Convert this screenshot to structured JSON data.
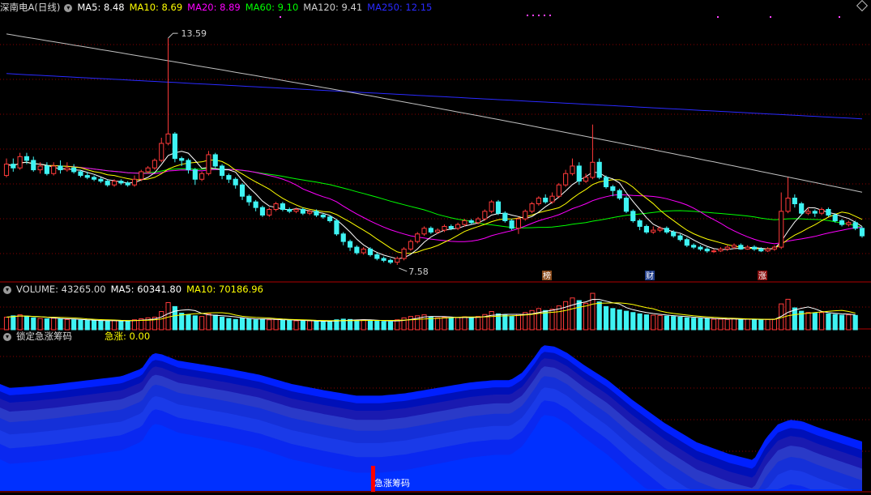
{
  "main_header": {
    "stock": "深南电A(日线)",
    "ma5": "MA5: 8.48",
    "ma10": "MA10: 8.69",
    "ma20": "MA20: 8.89",
    "ma60": "MA60: 9.10",
    "ma120": "MA120: 9.41",
    "ma250": "MA250: 12.15"
  },
  "volume_header": {
    "volume": "VOLUME: 43265.00",
    "ma5": "MA5: 60341.80",
    "ma10": "MA10: 70186.96"
  },
  "indicator_header": {
    "name": "锁定急涨筹码",
    "value": "急涨: 0.00"
  },
  "annotations": {
    "high": "13.59",
    "low": "7.58",
    "tag_bang": "榜",
    "tag_cai": "财",
    "tag_zhang": "涨",
    "signal": "急涨筹码"
  },
  "colors": {
    "up": "#ff3a3a",
    "down": "#3ff3f3",
    "ma5": "#ffffff",
    "ma10": "#ffff00",
    "ma20": "#ff00ff",
    "ma60": "#00ff00",
    "ma120": "#c0c0c0",
    "ma250": "#2a2aff",
    "grid": "#8b0000",
    "fill": "#0000ff"
  },
  "chart_data": {
    "type": "candlestick",
    "ylim": [
      7.3,
      14.3
    ],
    "ylim_volume": [
      0,
      115000
    ],
    "high_marker": 13.59,
    "low_marker": 7.58,
    "candles": [
      [
        9.95,
        10.25,
        10.4,
        9.9
      ],
      [
        10.25,
        10.15,
        10.4,
        10.05
      ],
      [
        10.15,
        10.45,
        10.55,
        10.1
      ],
      [
        10.45,
        10.35,
        10.55,
        10.25
      ],
      [
        10.35,
        10.1,
        10.45,
        10.05
      ],
      [
        10.1,
        10.2,
        10.3,
        10.0
      ],
      [
        10.2,
        10.0,
        10.3,
        9.95
      ],
      [
        10.0,
        10.2,
        10.3,
        9.95
      ],
      [
        10.2,
        10.1,
        10.35,
        10.0
      ],
      [
        10.1,
        10.15,
        10.3,
        10.05
      ],
      [
        10.15,
        10.05,
        10.25,
        10.0
      ],
      [
        10.05,
        9.95,
        10.1,
        9.9
      ],
      [
        9.95,
        9.9,
        10.05,
        9.85
      ],
      [
        9.9,
        9.85,
        9.95,
        9.8
      ],
      [
        9.85,
        9.8,
        9.9,
        9.75
      ],
      [
        9.8,
        9.7,
        9.85,
        9.65
      ],
      [
        9.7,
        9.8,
        9.85,
        9.65
      ],
      [
        9.8,
        9.75,
        9.85,
        9.7
      ],
      [
        9.75,
        9.7,
        9.8,
        9.65
      ],
      [
        9.7,
        9.85,
        9.95,
        9.65
      ],
      [
        9.85,
        10.05,
        10.1,
        9.8
      ],
      [
        10.05,
        10.15,
        10.2,
        10.0
      ],
      [
        10.15,
        10.35,
        10.4,
        10.1
      ],
      [
        10.35,
        10.8,
        10.95,
        10.3
      ],
      [
        10.8,
        11.05,
        13.59,
        10.75
      ],
      [
        11.05,
        10.4,
        11.1,
        10.3
      ],
      [
        10.4,
        10.35,
        10.45,
        10.2
      ],
      [
        10.35,
        10.1,
        10.4,
        10.0
      ],
      [
        10.1,
        9.85,
        10.15,
        9.7
      ],
      [
        9.85,
        10.0,
        10.05,
        9.8
      ],
      [
        10.0,
        10.5,
        10.6,
        9.95
      ],
      [
        10.5,
        10.2,
        10.55,
        10.15
      ],
      [
        10.2,
        9.95,
        10.25,
        9.85
      ],
      [
        9.95,
        9.85,
        10.0,
        9.75
      ],
      [
        9.85,
        9.7,
        9.9,
        9.6
      ],
      [
        9.7,
        9.4,
        9.75,
        9.3
      ],
      [
        9.4,
        9.25,
        9.45,
        9.15
      ],
      [
        9.25,
        9.1,
        9.3,
        9.0
      ],
      [
        9.1,
        8.9,
        9.15,
        8.85
      ],
      [
        8.9,
        9.05,
        9.1,
        8.85
      ],
      [
        9.05,
        9.2,
        9.25,
        9.0
      ],
      [
        9.2,
        9.05,
        9.25,
        9.0
      ],
      [
        9.05,
        9.0,
        9.1,
        8.95
      ],
      [
        9.0,
        9.05,
        9.1,
        8.95
      ],
      [
        9.05,
        8.95,
        9.1,
        8.9
      ],
      [
        8.95,
        9.0,
        9.05,
        8.9
      ],
      [
        9.0,
        8.9,
        9.05,
        8.85
      ],
      [
        8.9,
        8.85,
        8.95,
        8.8
      ],
      [
        8.85,
        8.75,
        8.9,
        8.7
      ],
      [
        8.75,
        8.4,
        8.8,
        8.35
      ],
      [
        8.4,
        8.2,
        8.45,
        8.1
      ],
      [
        8.2,
        8.05,
        8.25,
        7.95
      ],
      [
        8.05,
        7.9,
        8.1,
        7.85
      ],
      [
        7.9,
        8.0,
        8.05,
        7.85
      ],
      [
        8.0,
        7.85,
        8.05,
        7.8
      ],
      [
        7.85,
        7.75,
        7.9,
        7.7
      ],
      [
        7.75,
        7.7,
        7.8,
        7.65
      ],
      [
        7.7,
        7.65,
        7.75,
        7.6
      ],
      [
        7.65,
        7.75,
        7.8,
        7.58
      ],
      [
        7.75,
        8.0,
        8.05,
        7.7
      ],
      [
        8.0,
        8.2,
        8.25,
        7.95
      ],
      [
        8.2,
        8.4,
        8.45,
        8.15
      ],
      [
        8.4,
        8.55,
        8.6,
        8.35
      ],
      [
        8.55,
        8.45,
        8.6,
        8.4
      ],
      [
        8.45,
        8.5,
        8.55,
        8.4
      ],
      [
        8.5,
        8.6,
        8.65,
        8.45
      ],
      [
        8.6,
        8.55,
        8.65,
        8.5
      ],
      [
        8.55,
        8.65,
        8.7,
        8.5
      ],
      [
        8.65,
        8.75,
        8.8,
        8.6
      ],
      [
        8.75,
        8.7,
        8.8,
        8.65
      ],
      [
        8.7,
        8.8,
        8.85,
        8.65
      ],
      [
        8.8,
        9.0,
        9.05,
        8.75
      ],
      [
        9.0,
        9.25,
        9.3,
        8.95
      ],
      [
        9.25,
        8.95,
        9.3,
        8.9
      ],
      [
        8.95,
        8.75,
        9.0,
        8.7
      ],
      [
        8.75,
        8.55,
        8.8,
        8.5
      ],
      [
        8.55,
        8.8,
        8.85,
        8.4
      ],
      [
        8.8,
        9.0,
        9.05,
        8.75
      ],
      [
        9.0,
        9.2,
        9.25,
        8.95
      ],
      [
        9.2,
        9.35,
        9.4,
        9.15
      ],
      [
        9.35,
        9.25,
        9.45,
        9.2
      ],
      [
        9.25,
        9.4,
        9.5,
        9.2
      ],
      [
        9.4,
        9.7,
        9.75,
        9.35
      ],
      [
        9.7,
        10.0,
        10.1,
        9.65
      ],
      [
        10.0,
        10.2,
        10.4,
        9.95
      ],
      [
        10.2,
        9.8,
        10.3,
        9.7
      ],
      [
        9.8,
        9.9,
        10.0,
        9.75
      ],
      [
        9.9,
        10.3,
        11.3,
        9.85
      ],
      [
        10.3,
        9.9,
        10.4,
        9.85
      ],
      [
        9.9,
        9.65,
        9.95,
        9.6
      ],
      [
        9.65,
        9.55,
        9.7,
        9.4
      ],
      [
        9.55,
        9.35,
        9.6,
        9.3
      ],
      [
        9.35,
        9.0,
        9.4,
        8.95
      ],
      [
        9.0,
        8.75,
        9.05,
        8.7
      ],
      [
        8.75,
        8.6,
        8.8,
        8.5
      ],
      [
        8.6,
        8.45,
        8.65,
        8.4
      ],
      [
        8.45,
        8.5,
        8.6,
        8.4
      ],
      [
        8.5,
        8.55,
        8.6,
        8.45
      ],
      [
        8.55,
        8.45,
        8.6,
        8.4
      ],
      [
        8.45,
        8.35,
        8.5,
        8.3
      ],
      [
        8.35,
        8.25,
        8.4,
        8.2
      ],
      [
        8.25,
        8.1,
        8.3,
        8.05
      ],
      [
        8.1,
        8.05,
        8.15,
        8.0
      ],
      [
        8.05,
        8.0,
        8.1,
        7.95
      ],
      [
        8.0,
        7.95,
        8.05,
        7.9
      ],
      [
        7.95,
        7.95,
        8.0,
        7.9
      ],
      [
        7.95,
        8.0,
        8.05,
        7.92
      ],
      [
        8.0,
        8.05,
        8.1,
        7.95
      ],
      [
        8.05,
        8.1,
        8.15,
        8.0
      ],
      [
        8.1,
        8.0,
        8.15,
        7.98
      ],
      [
        8.0,
        8.05,
        8.1,
        7.98
      ],
      [
        8.05,
        8.0,
        8.1,
        7.95
      ],
      [
        8.0,
        7.95,
        8.05,
        7.92
      ],
      [
        7.95,
        8.0,
        8.05,
        7.92
      ],
      [
        8.0,
        8.05,
        8.1,
        7.95
      ],
      [
        8.05,
        9.0,
        9.5,
        8.0
      ],
      [
        9.0,
        9.35,
        9.9,
        8.95
      ],
      [
        9.35,
        9.2,
        9.45,
        9.1
      ],
      [
        9.2,
        8.95,
        9.25,
        8.9
      ],
      [
        8.95,
        9.0,
        9.1,
        8.9
      ],
      [
        9.0,
        8.95,
        9.05,
        8.85
      ],
      [
        8.95,
        9.05,
        9.1,
        8.9
      ],
      [
        9.05,
        8.9,
        9.1,
        8.85
      ],
      [
        8.9,
        8.75,
        8.95,
        8.7
      ],
      [
        8.75,
        8.65,
        8.8,
        8.6
      ],
      [
        8.65,
        8.7,
        8.75,
        8.6
      ],
      [
        8.7,
        8.55,
        8.75,
        8.5
      ],
      [
        8.55,
        8.35,
        8.6,
        8.3
      ]
    ],
    "volume": [
      38000,
      42000,
      45000,
      40000,
      36000,
      34000,
      33000,
      35000,
      32000,
      31000,
      30000,
      29000,
      28000,
      27000,
      26000,
      27000,
      28000,
      27000,
      26000,
      30000,
      33000,
      36000,
      38000,
      55000,
      82000,
      70000,
      50000,
      45000,
      42000,
      40000,
      48000,
      44000,
      38000,
      34000,
      31000,
      35000,
      33000,
      30000,
      32000,
      30000,
      31000,
      29000,
      28000,
      27000,
      26000,
      27000,
      25000,
      24000,
      26000,
      30000,
      32000,
      31000,
      29000,
      30000,
      28000,
      26000,
      25000,
      24000,
      30000,
      36000,
      40000,
      42000,
      45000,
      38000,
      36000,
      38000,
      35000,
      37000,
      39000,
      36000,
      40000,
      46000,
      55000,
      48000,
      44000,
      40000,
      46000,
      52000,
      58000,
      64000,
      58000,
      62000,
      72000,
      85000,
      96000,
      88000,
      80000,
      110000,
      84000,
      70000,
      64000,
      60000,
      56000,
      52000,
      48000,
      45000,
      44000,
      43000,
      41000,
      40000,
      38000,
      36000,
      35000,
      34000,
      33000,
      32000,
      32000,
      31000,
      33000,
      31000,
      32000,
      31000,
      30000,
      31000,
      32000,
      78000,
      92000,
      66000,
      56000,
      52000,
      50000,
      52000,
      48000,
      46000,
      44000,
      45000,
      43265
    ],
    "signal_value": 0.0
  }
}
